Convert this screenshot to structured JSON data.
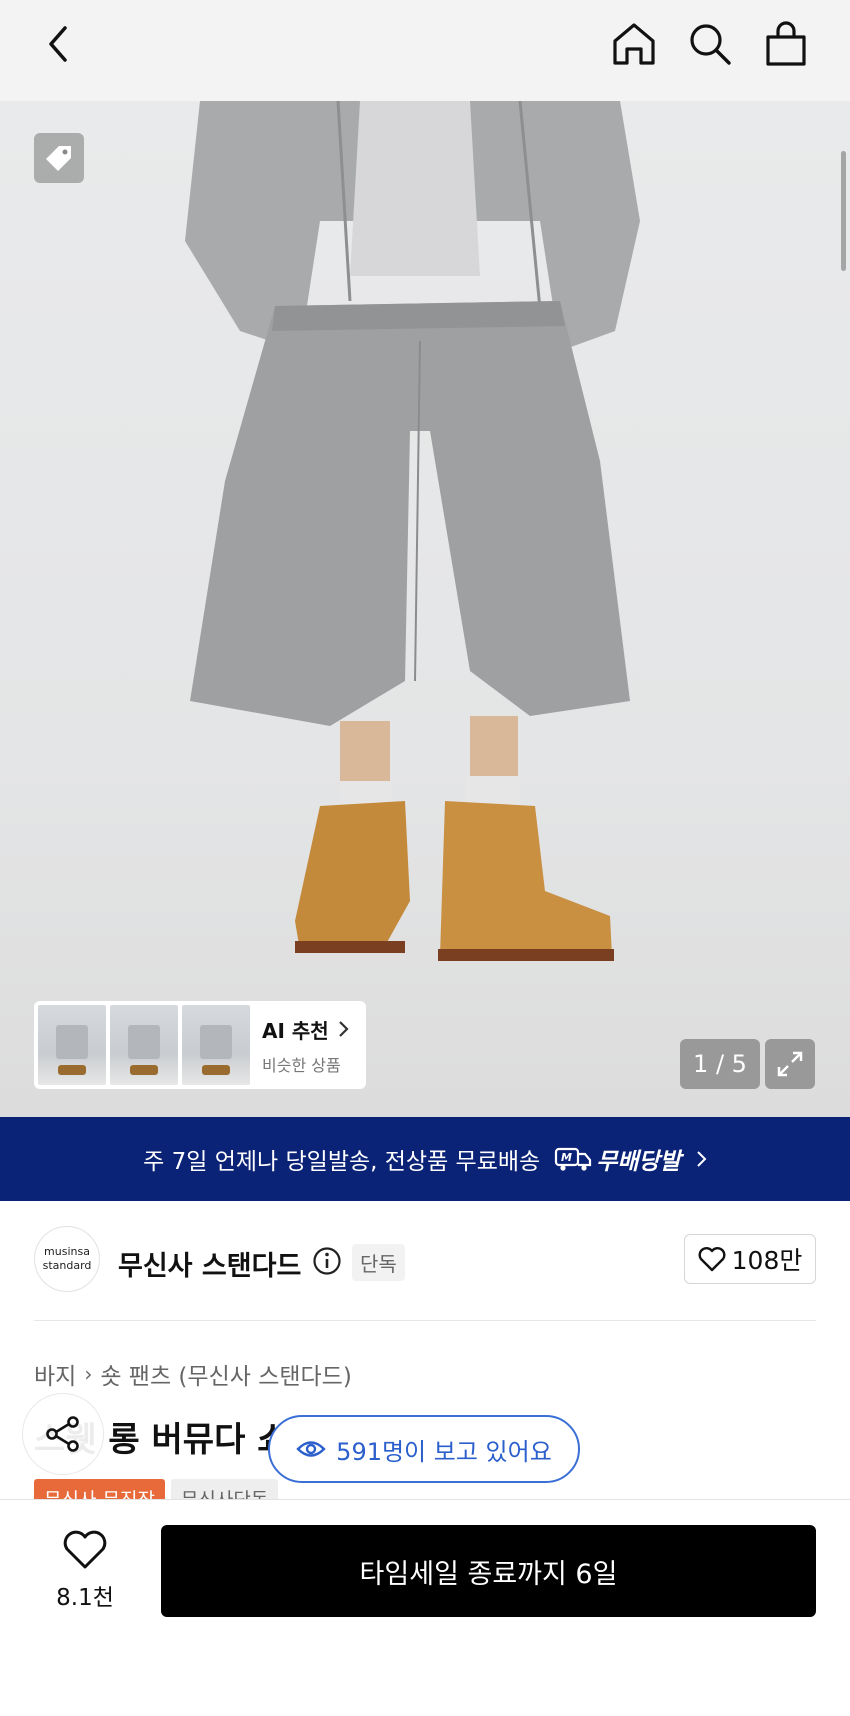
{
  "hero": {
    "counter": "1 / 5",
    "ai_recommend": {
      "title": "AI 추천",
      "subtitle": "비슷한 상품"
    }
  },
  "banner": {
    "text": "주 7일 언제나 당일발송, 전상품 무료배송",
    "logo_text": "무배당발"
  },
  "brand": {
    "logo_line1": "musinsa",
    "logo_line2": "standard",
    "name": "무신사 스탠다드",
    "exclusive_badge": "단독",
    "like_count": "108만"
  },
  "breadcrumb": [
    "바지",
    "숏 팬츠 (무신사 스탠다드)"
  ],
  "product": {
    "title": "스웻 롱 버뮤다 쇼츠 [멜란지 그레이]",
    "badges": [
      "무신사 무진장",
      "무신사단독"
    ]
  },
  "viewers_text": "591명이 보고 있어요",
  "bottom": {
    "wish_count": "8.1천",
    "buy_label": "타임세일 종료까지 6일"
  },
  "colors": {
    "banner_bg": "#0b2377",
    "viewer_accent": "#2b5fcc",
    "badge_orange": "#e86a3a"
  },
  "icons": [
    "back-icon",
    "home-icon",
    "search-icon",
    "bag-icon",
    "tag-icon",
    "expand-icon",
    "info-icon",
    "heart-icon",
    "share-icon",
    "eye-icon"
  ]
}
